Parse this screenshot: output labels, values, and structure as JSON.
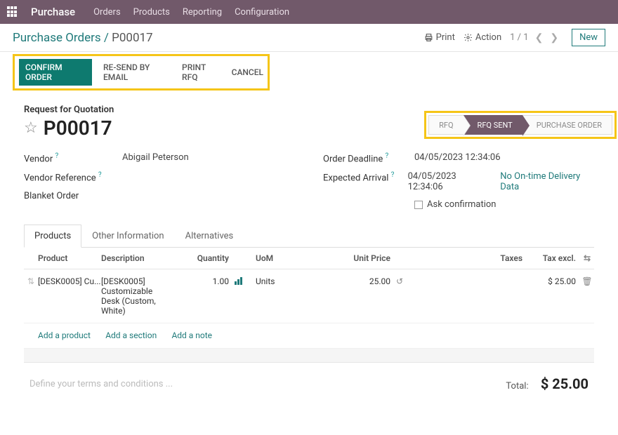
{
  "topbar": {
    "app": "Purchase",
    "menu": [
      "Orders",
      "Products",
      "Reporting",
      "Configuration"
    ]
  },
  "header": {
    "breadcrumb_root": "Purchase Orders",
    "breadcrumb_sep": " / ",
    "breadcrumb_current": "P00017",
    "print": "Print",
    "action": "Action",
    "pager": "1 / 1",
    "new_btn": "New"
  },
  "actions": {
    "confirm": "CONFIRM ORDER",
    "resend": "RE-SEND BY EMAIL",
    "print_rfq": "PRINT RFQ",
    "cancel": "CANCEL"
  },
  "status": {
    "rfq": "RFQ",
    "rfq_sent": "RFQ SENT",
    "po": "PURCHASE ORDER"
  },
  "form": {
    "rfq_label": "Request for Quotation",
    "name": "P00017",
    "vendor_label": "Vendor",
    "vendor": "Abigail Peterson",
    "vendor_ref_label": "Vendor Reference",
    "blanket_label": "Blanket Order",
    "deadline_label": "Order Deadline",
    "deadline": "04/05/2023 12:34:06",
    "arrival_label": "Expected Arrival",
    "arrival": "04/05/2023 12:34:06",
    "ontime": "No On-time Delivery Data",
    "ask_conf": "Ask confirmation"
  },
  "tabs": {
    "products": "Products",
    "other": "Other Information",
    "alt": "Alternatives"
  },
  "table": {
    "headers": {
      "product": "Product",
      "desc": "Description",
      "qty": "Quantity",
      "uom": "UoM",
      "price": "Unit Price",
      "taxes": "Taxes",
      "taxexcl": "Tax excl."
    },
    "rows": [
      {
        "product": "[DESK0005] Cu...",
        "desc": "[DESK0005] Customizable Desk (Custom, White)",
        "qty": "1.00",
        "uom": "Units",
        "price": "25.00",
        "taxexcl": "$ 25.00"
      }
    ],
    "add_product": "Add a product",
    "add_section": "Add a section",
    "add_note": "Add a note"
  },
  "footer": {
    "terms_placeholder": "Define your terms and conditions ...",
    "total_label": "Total:",
    "total_value": "$ 25.00"
  },
  "help_marker": "?"
}
